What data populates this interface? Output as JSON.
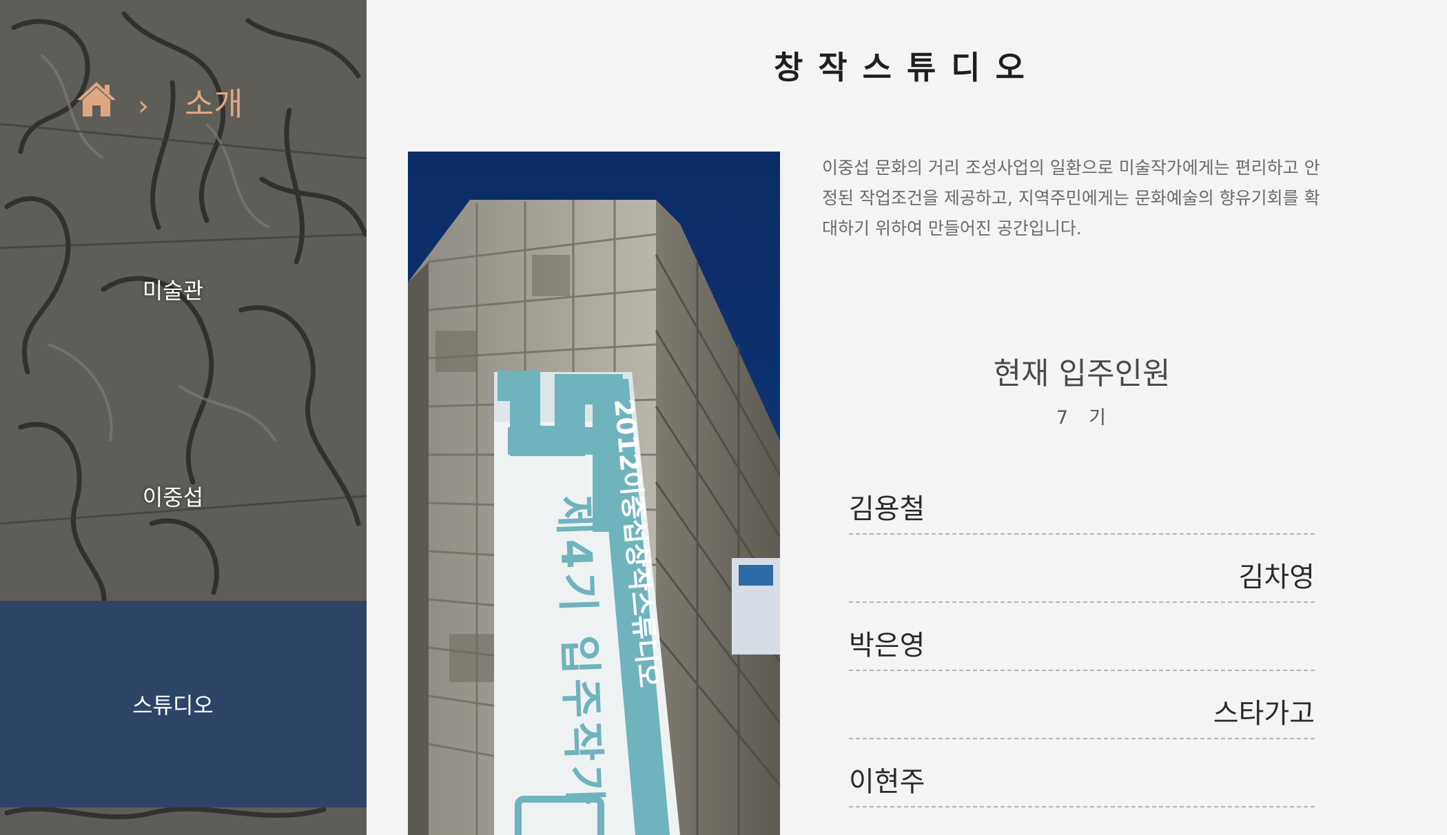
{
  "breadcrumb": {
    "home_icon": "home-icon",
    "separator": "›",
    "current": "소개"
  },
  "sidebar": {
    "items": [
      {
        "label": "미술관",
        "active": false
      },
      {
        "label": "이중섭",
        "active": false
      },
      {
        "label": "스튜디오",
        "active": true
      }
    ]
  },
  "page": {
    "title": "창작스튜디오"
  },
  "intro": {
    "lines": [
      "이중섭 문화의 거리 조성사업의 일환으로 미술작가에게는 편리하고 안",
      "정된 작업조건을 제공하고, 지역주민에게는 문화예술의 향유기회를 확",
      "대하기 위하여 만들어진 공간입니다."
    ]
  },
  "residents": {
    "title": "현재 입주인원",
    "generation_number": "7",
    "generation_suffix": "기",
    "names": [
      "김용철",
      "김차영",
      "박은영",
      "스타가고",
      "이현주"
    ]
  },
  "banner": {
    "number": "4",
    "vertical_text": "2012이중섭창작스튜디오",
    "main_text": "제4기 입주작가"
  },
  "colors": {
    "accent": "#e0a682",
    "active_nav": "#2e4467",
    "sky": "#0c2f6b",
    "banner_teal": "#6fb3bd"
  }
}
